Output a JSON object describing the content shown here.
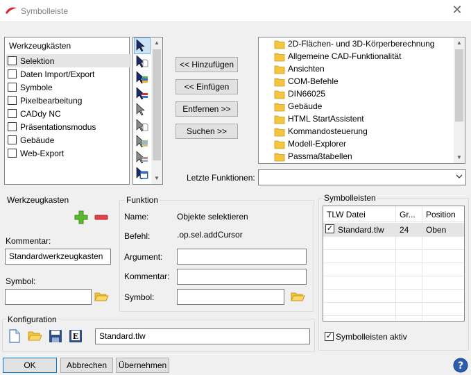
{
  "window": {
    "title": "Symbolleiste",
    "close_glyph": "✕"
  },
  "toolboxes": {
    "header": "Werkzeugkästen",
    "items": [
      {
        "label": "Selektion",
        "checked": false,
        "selected": true
      },
      {
        "label": "Daten Import/Export",
        "checked": false
      },
      {
        "label": "Symbole",
        "checked": false
      },
      {
        "label": "Pixelbearbeitung",
        "checked": false
      },
      {
        "label": "CADdy NC",
        "checked": false
      },
      {
        "label": "Präsentationsmodus",
        "checked": false
      },
      {
        "label": "Gebäude",
        "checked": false
      },
      {
        "label": "Web-Export",
        "checked": false
      }
    ]
  },
  "tool_icons": [
    "select-cursor-icon",
    "select-document-icon",
    "select-layers-icon",
    "select-stack-icon",
    "gray-cursor-icon",
    "gray-document-icon",
    "gray-layers-icon",
    "gray-stack-icon",
    "select-window-icon"
  ],
  "buttons": {
    "add": "<< Hinzufügen",
    "insert": "<< Einfügen",
    "remove": "Entfernen >>",
    "search": "Suchen >>",
    "ok": "OK",
    "cancel": "Abbrechen",
    "apply": "Übernehmen"
  },
  "categories": [
    "2D-Flächen- und 3D-Körperberechnung",
    "Allgemeine CAD-Funktionalität",
    "Ansichten",
    "COM-Befehle",
    "DIN66025",
    "Gebäude",
    "HTML StartAssistent",
    "Kommandosteuerung",
    "Modell-Explorer",
    "Passmaßtabellen"
  ],
  "recent": {
    "label": "Letzte Funktionen:",
    "value": ""
  },
  "toolbox_group": {
    "title": "Werkzeugkasten",
    "comment_label": "Kommentar:",
    "comment_value": "Standardwerkzeugkasten",
    "symbol_label": "Symbol:",
    "symbol_value": ""
  },
  "function_group": {
    "title": "Funktion",
    "name_label": "Name:",
    "name_value": "Objekte selektieren",
    "command_label": "Befehl:",
    "command_value": ".op.sel.addCursor",
    "argument_label": "Argument:",
    "argument_value": "",
    "comment_label": "Kommentar:",
    "comment_value": "",
    "symbol_label": "Symbol:",
    "symbol_value": ""
  },
  "toolbars": {
    "title": "Symbolleisten",
    "columns": [
      "TLW Datei",
      "Gr...",
      "Position"
    ],
    "rows": [
      {
        "file": "Standard.tlw",
        "size": "24",
        "position": "Oben",
        "checked": true
      }
    ],
    "active_label": "Symbolleisten aktiv",
    "active_checked": true
  },
  "config": {
    "title": "Konfiguration",
    "file_value": "Standard.tlw"
  },
  "colors": {
    "accent": "#0078d7",
    "selection": "#e5e5e5",
    "folder": "#f5c440",
    "add_green": "#5cb82e",
    "remove_red": "#e0444a"
  }
}
